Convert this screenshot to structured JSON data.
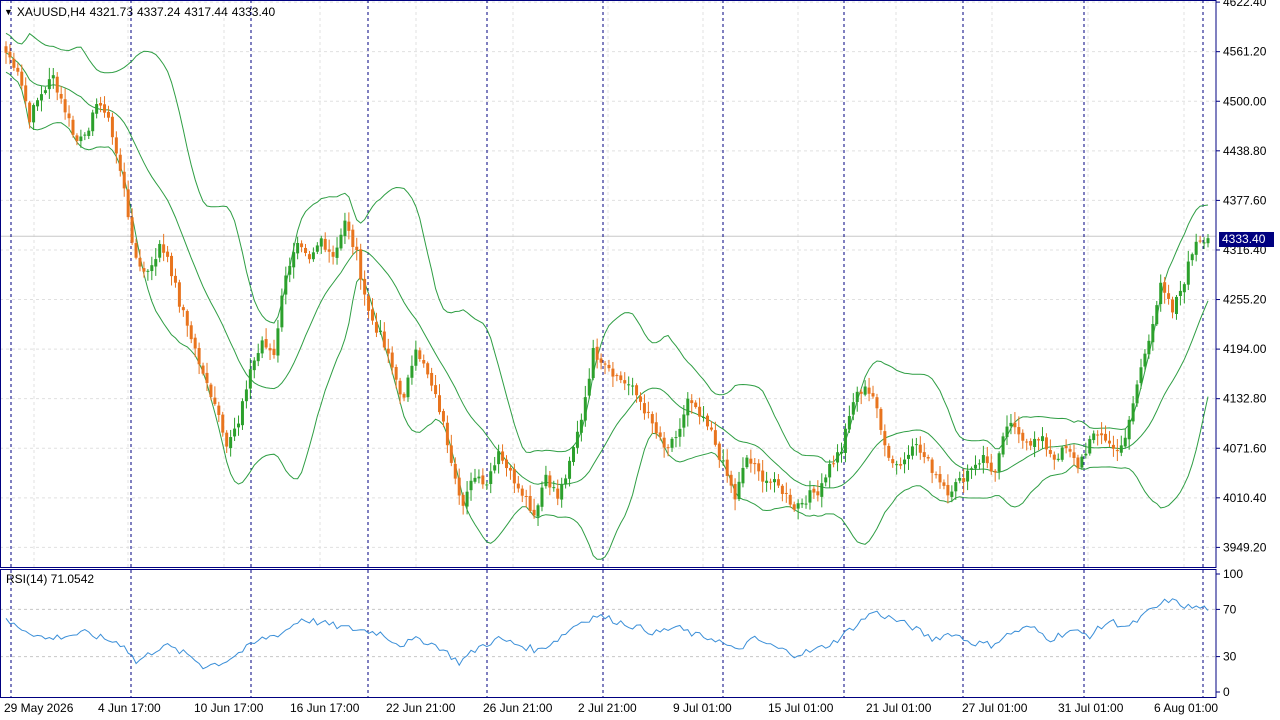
{
  "header": {
    "symbol": "XAUUSD,H4",
    "open": "4321.73",
    "high": "4337.24",
    "low": "4317.44",
    "close": "4333.40"
  },
  "current_price": "4333.40",
  "rsi_label": "RSI(14) 71.0542",
  "colors": {
    "bull": "#2ca02c",
    "bear": "#e8741e",
    "bands": "#2f9e44",
    "rsi": "#3b8fd8",
    "axis": "#000080",
    "grid": "#e0e0e0",
    "separator": "#000080"
  },
  "chart_data": [
    {
      "type": "candlestick",
      "title": "XAUUSD,H4",
      "indicator": "Bollinger Bands",
      "grid": true,
      "ylim": [
        3925,
        4625
      ],
      "y_ticks": [
        "4622.40",
        "4561.20",
        "4500.00",
        "4438.80",
        "4377.60",
        "4316.40",
        "4255.20",
        "4194.00",
        "4132.80",
        "4071.60",
        "4010.40",
        "3949.20"
      ],
      "x_labels": [
        "29 May 2026",
        "4 Jun 17:00",
        "10 Jun 17:00",
        "16 Jun 17:00",
        "22 Jun 21:00",
        "26 Jun 21:00",
        "2 Jul 21:00",
        "9 Jul 01:00",
        "15 Jul 01:00",
        "21 Jul 01:00",
        "27 Jul 01:00",
        "31 Jul 01:00",
        "6 Aug 01:00"
      ],
      "close_path": [
        [
          0,
          4560
        ],
        [
          3,
          4540
        ],
        [
          6,
          4480
        ],
        [
          9,
          4510
        ],
        [
          12,
          4530
        ],
        [
          15,
          4490
        ],
        [
          18,
          4450
        ],
        [
          21,
          4470
        ],
        [
          24,
          4500
        ],
        [
          27,
          4460
        ],
        [
          30,
          4390
        ],
        [
          33,
          4300
        ],
        [
          36,
          4290
        ],
        [
          39,
          4320
        ],
        [
          41,
          4310
        ],
        [
          44,
          4250
        ],
        [
          47,
          4210
        ],
        [
          50,
          4160
        ],
        [
          53,
          4130
        ],
        [
          56,
          4080
        ],
        [
          59,
          4100
        ],
        [
          62,
          4170
        ],
        [
          65,
          4200
        ],
        [
          68,
          4190
        ],
        [
          71,
          4290
        ],
        [
          74,
          4320
        ],
        [
          77,
          4300
        ],
        [
          80,
          4330
        ],
        [
          83,
          4310
        ],
        [
          86,
          4350
        ],
        [
          89,
          4310
        ],
        [
          92,
          4240
        ],
        [
          95,
          4210
        ],
        [
          98,
          4170
        ],
        [
          101,
          4130
        ],
        [
          104,
          4200
        ],
        [
          107,
          4160
        ],
        [
          110,
          4120
        ],
        [
          113,
          4060
        ],
        [
          116,
          4000
        ],
        [
          119,
          4040
        ],
        [
          122,
          4030
        ],
        [
          125,
          4070
        ],
        [
          128,
          4040
        ],
        [
          131,
          4020
        ],
        [
          134,
          3990
        ],
        [
          137,
          4040
        ],
        [
          140,
          4010
        ],
        [
          143,
          4050
        ],
        [
          146,
          4110
        ],
        [
          149,
          4190
        ],
        [
          152,
          4180
        ],
        [
          155,
          4160
        ],
        [
          158,
          4150
        ],
        [
          161,
          4130
        ],
        [
          164,
          4100
        ],
        [
          167,
          4070
        ],
        [
          170,
          4080
        ],
        [
          173,
          4130
        ],
        [
          176,
          4110
        ],
        [
          179,
          4090
        ],
        [
          182,
          4050
        ],
        [
          185,
          4010
        ],
        [
          188,
          4060
        ],
        [
          191,
          4040
        ],
        [
          194,
          4030
        ],
        [
          197,
          4020
        ],
        [
          200,
          4000
        ],
        [
          203,
          4010
        ],
        [
          206,
          4020
        ],
        [
          209,
          4050
        ],
        [
          212,
          4070
        ],
        [
          215,
          4130
        ],
        [
          218,
          4150
        ],
        [
          221,
          4120
        ],
        [
          224,
          4060
        ],
        [
          227,
          4050
        ],
        [
          230,
          4080
        ],
        [
          233,
          4060
        ],
        [
          236,
          4040
        ],
        [
          239,
          4020
        ],
        [
          242,
          4030
        ],
        [
          245,
          4050
        ],
        [
          248,
          4060
        ],
        [
          251,
          4040
        ],
        [
          254,
          4100
        ],
        [
          257,
          4090
        ],
        [
          260,
          4080
        ],
        [
          263,
          4080
        ],
        [
          266,
          4060
        ],
        [
          269,
          4070
        ],
        [
          272,
          4050
        ],
        [
          275,
          4080
        ],
        [
          278,
          4090
        ],
        [
          281,
          4070
        ],
        [
          284,
          4080
        ],
        [
          287,
          4150
        ],
        [
          290,
          4210
        ],
        [
          293,
          4270
        ],
        [
          296,
          4240
        ],
        [
          299,
          4280
        ],
        [
          302,
          4330
        ],
        [
          305,
          4333
        ]
      ]
    },
    {
      "type": "line",
      "title": "RSI(14)",
      "ylim": [
        0,
        100
      ],
      "y_ticks": [
        "100",
        "70",
        "30",
        "0"
      ],
      "levels": [
        70,
        30
      ],
      "values_path": [
        [
          0,
          60
        ],
        [
          10,
          45
        ],
        [
          20,
          50
        ],
        [
          30,
          40
        ],
        [
          33,
          25
        ],
        [
          40,
          40
        ],
        [
          47,
          30
        ],
        [
          50,
          22
        ],
        [
          55,
          25
        ],
        [
          60,
          35
        ],
        [
          65,
          45
        ],
        [
          70,
          50
        ],
        [
          75,
          62
        ],
        [
          85,
          55
        ],
        [
          95,
          50
        ],
        [
          100,
          40
        ],
        [
          105,
          45
        ],
        [
          110,
          38
        ],
        [
          115,
          25
        ],
        [
          120,
          38
        ],
        [
          125,
          45
        ],
        [
          130,
          40
        ],
        [
          135,
          35
        ],
        [
          140,
          45
        ],
        [
          145,
          58
        ],
        [
          150,
          65
        ],
        [
          155,
          60
        ],
        [
          160,
          55
        ],
        [
          165,
          50
        ],
        [
          170,
          55
        ],
        [
          175,
          48
        ],
        [
          180,
          45
        ],
        [
          185,
          35
        ],
        [
          190,
          45
        ],
        [
          195,
          38
        ],
        [
          200,
          32
        ],
        [
          205,
          35
        ],
        [
          210,
          42
        ],
        [
          215,
          55
        ],
        [
          220,
          68
        ],
        [
          225,
          62
        ],
        [
          230,
          55
        ],
        [
          235,
          45
        ],
        [
          240,
          50
        ],
        [
          245,
          42
        ],
        [
          250,
          40
        ],
        [
          255,
          50
        ],
        [
          260,
          55
        ],
        [
          265,
          45
        ],
        [
          270,
          52
        ],
        [
          275,
          48
        ],
        [
          280,
          60
        ],
        [
          285,
          55
        ],
        [
          290,
          68
        ],
        [
          295,
          78
        ],
        [
          300,
          72
        ],
        [
          305,
          71
        ]
      ]
    }
  ]
}
